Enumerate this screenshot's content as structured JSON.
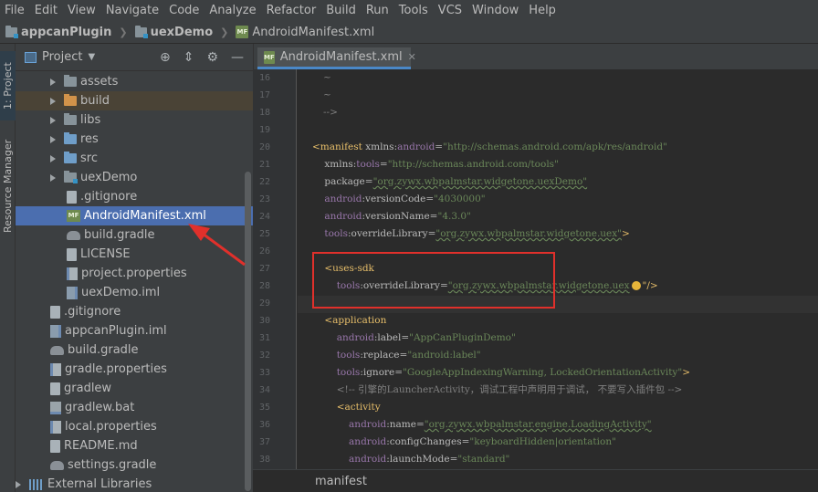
{
  "menu": [
    "File",
    "Edit",
    "View",
    "Navigate",
    "Code",
    "Analyze",
    "Refactor",
    "Build",
    "Run",
    "Tools",
    "VCS",
    "Window",
    "Help"
  ],
  "breadcrumb": [
    "appcanPlugin",
    "uexDemo",
    "AndroidManifest.xml"
  ],
  "stripe": {
    "project_tab": "1: Project",
    "resource_tab": "Resource Manager"
  },
  "project_panel": {
    "title": "Project",
    "tree": [
      {
        "label": "assets",
        "icon": "folder-icon",
        "expandable": true
      },
      {
        "label": "build",
        "icon": "folder-icon",
        "expandable": true
      },
      {
        "label": "libs",
        "icon": "folder-icon",
        "expandable": true
      },
      {
        "label": "res",
        "icon": "folder-icon",
        "expandable": true
      },
      {
        "label": "src",
        "icon": "folder-icon",
        "expandable": true
      },
      {
        "label": "uexDemo",
        "icon": "folder-icon",
        "expandable": true
      },
      {
        "label": ".gitignore",
        "icon": "file-icon",
        "expandable": false
      },
      {
        "label": "AndroidManifest.xml",
        "icon": "manifest-icon",
        "expandable": false
      },
      {
        "label": "build.gradle",
        "icon": "gradle-icon",
        "expandable": false
      },
      {
        "label": "LICENSE",
        "icon": "file-icon",
        "expandable": false
      },
      {
        "label": "project.properties",
        "icon": "properties-icon",
        "expandable": false
      },
      {
        "label": "uexDemo.iml",
        "icon": "iml-icon",
        "expandable": false
      },
      {
        "label": ".gitignore",
        "icon": "file-icon",
        "expandable": false
      },
      {
        "label": "appcanPlugin.iml",
        "icon": "iml-icon",
        "expandable": false
      },
      {
        "label": "build.gradle",
        "icon": "gradle-icon",
        "expandable": false
      },
      {
        "label": "gradle.properties",
        "icon": "properties-icon",
        "expandable": false
      },
      {
        "label": "gradlew",
        "icon": "file-icon",
        "expandable": false
      },
      {
        "label": "gradlew.bat",
        "icon": "bat-icon",
        "expandable": false
      },
      {
        "label": "local.properties",
        "icon": "properties-icon",
        "expandable": false
      },
      {
        "label": "README.md",
        "icon": "file-icon",
        "expandable": false
      },
      {
        "label": "settings.gradle",
        "icon": "gradle-icon",
        "expandable": false
      },
      {
        "label": "External Libraries",
        "icon": "libraries-icon",
        "expandable": true
      }
    ]
  },
  "editor": {
    "tab_label": "AndroidManifest.xml",
    "line_numbers": [
      "16",
      "17",
      "18",
      "19",
      "20",
      "21",
      "22",
      "23",
      "24",
      "25",
      "26",
      "27",
      "28",
      "29",
      "30",
      "31",
      "32",
      "33",
      "34",
      "35",
      "36",
      "37",
      "38"
    ],
    "code_lines": [
      [
        {
          "t": "~",
          "c": "cmt"
        }
      ],
      [
        {
          "t": "~",
          "c": "cmt"
        }
      ],
      [
        {
          "t": "-->",
          "c": "cmt"
        }
      ],
      [],
      [
        {
          "t": "<manifest ",
          "c": "tag"
        },
        {
          "t": "xmlns:",
          "c": "attr"
        },
        {
          "t": "android",
          "c": "ns"
        },
        {
          "t": "=",
          "c": "attr"
        },
        {
          "t": "\"http://schemas.android.com/apk/res/android\"",
          "c": "val"
        }
      ],
      [
        {
          "t": "    xmlns:",
          "c": "attr"
        },
        {
          "t": "tools",
          "c": "ns"
        },
        {
          "t": "=",
          "c": "attr"
        },
        {
          "t": "\"http://schemas.android.com/tools\"",
          "c": "val"
        }
      ],
      [
        {
          "t": "    package",
          "c": "attr"
        },
        {
          "t": "=",
          "c": "attr"
        },
        {
          "t": "\"org.zywx.wbpalmstar.widgetone.uexDemo\"",
          "c": "val",
          "squig": true
        }
      ],
      [
        {
          "t": "    android",
          "c": "ns"
        },
        {
          "t": ":versionCode",
          "c": "attr"
        },
        {
          "t": "=",
          "c": "attr"
        },
        {
          "t": "\"4030000\"",
          "c": "val"
        }
      ],
      [
        {
          "t": "    android",
          "c": "ns"
        },
        {
          "t": ":versionName",
          "c": "attr"
        },
        {
          "t": "=",
          "c": "attr"
        },
        {
          "t": "\"4.3.0\"",
          "c": "val"
        }
      ],
      [
        {
          "t": "    tools",
          "c": "ns"
        },
        {
          "t": ":overrideLibrary",
          "c": "attr"
        },
        {
          "t": "=",
          "c": "attr"
        },
        {
          "t": "\"org.zywx.wbpalmstar.widgetone.uex\"",
          "c": "val",
          "squig": true
        },
        {
          "t": ">",
          "c": "tag"
        }
      ],
      [],
      [
        {
          "t": "    <uses-sdk",
          "c": "tag"
        }
      ],
      [
        {
          "t": "        tools",
          "c": "ns"
        },
        {
          "t": ":overrideLibrary",
          "c": "attr"
        },
        {
          "t": "=",
          "c": "attr"
        },
        {
          "t": "\"org.zywx.wbpalmstar.widgetone.uex",
          "c": "val",
          "squig": true
        },
        {
          "t": "BULB",
          "c": "bulb"
        },
        {
          "t": "\"/>",
          "c": "tag"
        }
      ],
      [],
      [
        {
          "t": "    <application",
          "c": "tag"
        }
      ],
      [
        {
          "t": "        android",
          "c": "ns"
        },
        {
          "t": ":label",
          "c": "attr"
        },
        {
          "t": "=",
          "c": "attr"
        },
        {
          "t": "\"AppCanPluginDemo\"",
          "c": "val"
        }
      ],
      [
        {
          "t": "        tools",
          "c": "ns"
        },
        {
          "t": ":replace",
          "c": "attr"
        },
        {
          "t": "=",
          "c": "attr"
        },
        {
          "t": "\"android:label\"",
          "c": "val"
        }
      ],
      [
        {
          "t": "        tools",
          "c": "ns"
        },
        {
          "t": ":ignore",
          "c": "attr"
        },
        {
          "t": "=",
          "c": "attr"
        },
        {
          "t": "\"GoogleAppIndexingWarning, LockedOrientationActivity\"",
          "c": "val"
        },
        {
          "t": ">",
          "c": "tag"
        }
      ],
      [
        {
          "t": "        <!-- 引擎的LauncherActivity，调试工程中声明用于调试， 不要写入插件包 -->",
          "c": "cmt"
        }
      ],
      [
        {
          "t": "        <activity",
          "c": "tag"
        }
      ],
      [
        {
          "t": "            android",
          "c": "ns"
        },
        {
          "t": ":name",
          "c": "attr"
        },
        {
          "t": "=",
          "c": "attr"
        },
        {
          "t": "\"org.zywx.wbpalmstar.engine.LoadingActivity\"",
          "c": "val",
          "squig": true
        }
      ],
      [
        {
          "t": "            android",
          "c": "ns"
        },
        {
          "t": ":configChanges",
          "c": "attr"
        },
        {
          "t": "=",
          "c": "attr"
        },
        {
          "t": "\"keyboardHidden|orientation\"",
          "c": "val"
        }
      ],
      [
        {
          "t": "            android",
          "c": "ns"
        },
        {
          "t": ":launchMode",
          "c": "attr"
        },
        {
          "t": "=",
          "c": "attr"
        },
        {
          "t": "\"standard\"",
          "c": "val"
        }
      ]
    ],
    "status_path": "manifest"
  },
  "colors": {
    "selection": "#4b6eaf",
    "annotation_red": "#e0302b",
    "tag": "#e8bf6a",
    "value": "#6a8759"
  }
}
